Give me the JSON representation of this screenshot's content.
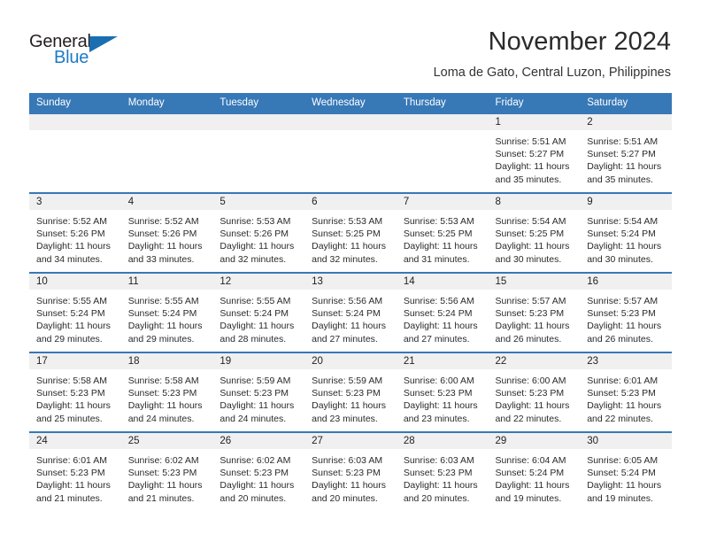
{
  "brand": {
    "name_part1": "General",
    "name_part2": "Blue"
  },
  "header": {
    "title": "November 2024",
    "location": "Loma de Gato, Central Luzon, Philippines"
  },
  "colors": {
    "header_blue": "#3778b7",
    "band_gray": "#f0f0f0",
    "logo_blue": "#1c7bc4",
    "text": "#222222"
  },
  "weekdays": [
    "Sunday",
    "Monday",
    "Tuesday",
    "Wednesday",
    "Thursday",
    "Friday",
    "Saturday"
  ],
  "weeks": [
    [
      {
        "day": "",
        "sunrise": "",
        "sunset": "",
        "daylight_line1": "",
        "daylight_line2": ""
      },
      {
        "day": "",
        "sunrise": "",
        "sunset": "",
        "daylight_line1": "",
        "daylight_line2": ""
      },
      {
        "day": "",
        "sunrise": "",
        "sunset": "",
        "daylight_line1": "",
        "daylight_line2": ""
      },
      {
        "day": "",
        "sunrise": "",
        "sunset": "",
        "daylight_line1": "",
        "daylight_line2": ""
      },
      {
        "day": "",
        "sunrise": "",
        "sunset": "",
        "daylight_line1": "",
        "daylight_line2": ""
      },
      {
        "day": "1",
        "sunrise": "Sunrise: 5:51 AM",
        "sunset": "Sunset: 5:27 PM",
        "daylight_line1": "Daylight: 11 hours",
        "daylight_line2": "and 35 minutes."
      },
      {
        "day": "2",
        "sunrise": "Sunrise: 5:51 AM",
        "sunset": "Sunset: 5:27 PM",
        "daylight_line1": "Daylight: 11 hours",
        "daylight_line2": "and 35 minutes."
      }
    ],
    [
      {
        "day": "3",
        "sunrise": "Sunrise: 5:52 AM",
        "sunset": "Sunset: 5:26 PM",
        "daylight_line1": "Daylight: 11 hours",
        "daylight_line2": "and 34 minutes."
      },
      {
        "day": "4",
        "sunrise": "Sunrise: 5:52 AM",
        "sunset": "Sunset: 5:26 PM",
        "daylight_line1": "Daylight: 11 hours",
        "daylight_line2": "and 33 minutes."
      },
      {
        "day": "5",
        "sunrise": "Sunrise: 5:53 AM",
        "sunset": "Sunset: 5:26 PM",
        "daylight_line1": "Daylight: 11 hours",
        "daylight_line2": "and 32 minutes."
      },
      {
        "day": "6",
        "sunrise": "Sunrise: 5:53 AM",
        "sunset": "Sunset: 5:25 PM",
        "daylight_line1": "Daylight: 11 hours",
        "daylight_line2": "and 32 minutes."
      },
      {
        "day": "7",
        "sunrise": "Sunrise: 5:53 AM",
        "sunset": "Sunset: 5:25 PM",
        "daylight_line1": "Daylight: 11 hours",
        "daylight_line2": "and 31 minutes."
      },
      {
        "day": "8",
        "sunrise": "Sunrise: 5:54 AM",
        "sunset": "Sunset: 5:25 PM",
        "daylight_line1": "Daylight: 11 hours",
        "daylight_line2": "and 30 minutes."
      },
      {
        "day": "9",
        "sunrise": "Sunrise: 5:54 AM",
        "sunset": "Sunset: 5:24 PM",
        "daylight_line1": "Daylight: 11 hours",
        "daylight_line2": "and 30 minutes."
      }
    ],
    [
      {
        "day": "10",
        "sunrise": "Sunrise: 5:55 AM",
        "sunset": "Sunset: 5:24 PM",
        "daylight_line1": "Daylight: 11 hours",
        "daylight_line2": "and 29 minutes."
      },
      {
        "day": "11",
        "sunrise": "Sunrise: 5:55 AM",
        "sunset": "Sunset: 5:24 PM",
        "daylight_line1": "Daylight: 11 hours",
        "daylight_line2": "and 29 minutes."
      },
      {
        "day": "12",
        "sunrise": "Sunrise: 5:55 AM",
        "sunset": "Sunset: 5:24 PM",
        "daylight_line1": "Daylight: 11 hours",
        "daylight_line2": "and 28 minutes."
      },
      {
        "day": "13",
        "sunrise": "Sunrise: 5:56 AM",
        "sunset": "Sunset: 5:24 PM",
        "daylight_line1": "Daylight: 11 hours",
        "daylight_line2": "and 27 minutes."
      },
      {
        "day": "14",
        "sunrise": "Sunrise: 5:56 AM",
        "sunset": "Sunset: 5:24 PM",
        "daylight_line1": "Daylight: 11 hours",
        "daylight_line2": "and 27 minutes."
      },
      {
        "day": "15",
        "sunrise": "Sunrise: 5:57 AM",
        "sunset": "Sunset: 5:23 PM",
        "daylight_line1": "Daylight: 11 hours",
        "daylight_line2": "and 26 minutes."
      },
      {
        "day": "16",
        "sunrise": "Sunrise: 5:57 AM",
        "sunset": "Sunset: 5:23 PM",
        "daylight_line1": "Daylight: 11 hours",
        "daylight_line2": "and 26 minutes."
      }
    ],
    [
      {
        "day": "17",
        "sunrise": "Sunrise: 5:58 AM",
        "sunset": "Sunset: 5:23 PM",
        "daylight_line1": "Daylight: 11 hours",
        "daylight_line2": "and 25 minutes."
      },
      {
        "day": "18",
        "sunrise": "Sunrise: 5:58 AM",
        "sunset": "Sunset: 5:23 PM",
        "daylight_line1": "Daylight: 11 hours",
        "daylight_line2": "and 24 minutes."
      },
      {
        "day": "19",
        "sunrise": "Sunrise: 5:59 AM",
        "sunset": "Sunset: 5:23 PM",
        "daylight_line1": "Daylight: 11 hours",
        "daylight_line2": "and 24 minutes."
      },
      {
        "day": "20",
        "sunrise": "Sunrise: 5:59 AM",
        "sunset": "Sunset: 5:23 PM",
        "daylight_line1": "Daylight: 11 hours",
        "daylight_line2": "and 23 minutes."
      },
      {
        "day": "21",
        "sunrise": "Sunrise: 6:00 AM",
        "sunset": "Sunset: 5:23 PM",
        "daylight_line1": "Daylight: 11 hours",
        "daylight_line2": "and 23 minutes."
      },
      {
        "day": "22",
        "sunrise": "Sunrise: 6:00 AM",
        "sunset": "Sunset: 5:23 PM",
        "daylight_line1": "Daylight: 11 hours",
        "daylight_line2": "and 22 minutes."
      },
      {
        "day": "23",
        "sunrise": "Sunrise: 6:01 AM",
        "sunset": "Sunset: 5:23 PM",
        "daylight_line1": "Daylight: 11 hours",
        "daylight_line2": "and 22 minutes."
      }
    ],
    [
      {
        "day": "24",
        "sunrise": "Sunrise: 6:01 AM",
        "sunset": "Sunset: 5:23 PM",
        "daylight_line1": "Daylight: 11 hours",
        "daylight_line2": "and 21 minutes."
      },
      {
        "day": "25",
        "sunrise": "Sunrise: 6:02 AM",
        "sunset": "Sunset: 5:23 PM",
        "daylight_line1": "Daylight: 11 hours",
        "daylight_line2": "and 21 minutes."
      },
      {
        "day": "26",
        "sunrise": "Sunrise: 6:02 AM",
        "sunset": "Sunset: 5:23 PM",
        "daylight_line1": "Daylight: 11 hours",
        "daylight_line2": "and 20 minutes."
      },
      {
        "day": "27",
        "sunrise": "Sunrise: 6:03 AM",
        "sunset": "Sunset: 5:23 PM",
        "daylight_line1": "Daylight: 11 hours",
        "daylight_line2": "and 20 minutes."
      },
      {
        "day": "28",
        "sunrise": "Sunrise: 6:03 AM",
        "sunset": "Sunset: 5:23 PM",
        "daylight_line1": "Daylight: 11 hours",
        "daylight_line2": "and 20 minutes."
      },
      {
        "day": "29",
        "sunrise": "Sunrise: 6:04 AM",
        "sunset": "Sunset: 5:24 PM",
        "daylight_line1": "Daylight: 11 hours",
        "daylight_line2": "and 19 minutes."
      },
      {
        "day": "30",
        "sunrise": "Sunrise: 6:05 AM",
        "sunset": "Sunset: 5:24 PM",
        "daylight_line1": "Daylight: 11 hours",
        "daylight_line2": "and 19 minutes."
      }
    ]
  ]
}
